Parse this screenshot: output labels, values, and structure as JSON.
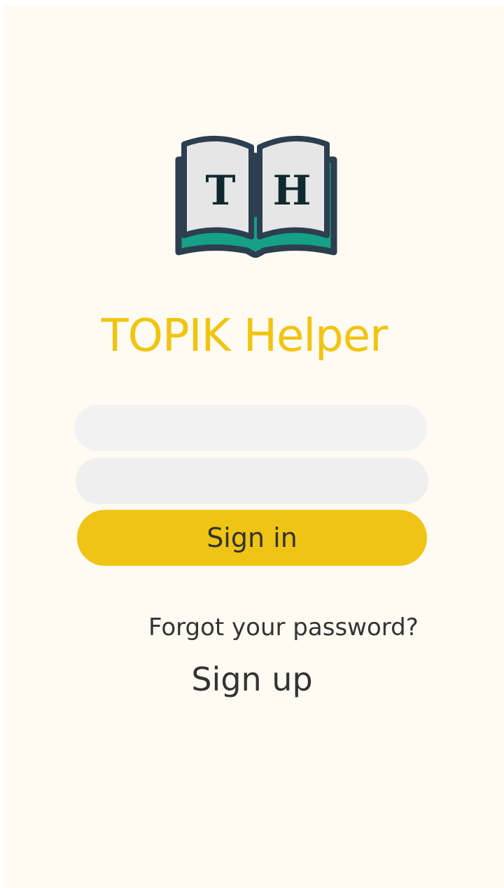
{
  "app": {
    "title": "TOPIK Helper",
    "logo": {
      "letter_left": "T",
      "letter_right": "H",
      "icon": "open-book-icon"
    }
  },
  "login": {
    "email_placeholder": "",
    "password_placeholder": "",
    "signin_label": "Sign in",
    "forgot_label": "Forgot your password?",
    "signup_label": "Sign up"
  },
  "colors": {
    "accent": "#f1c40f",
    "button": "#f0c414",
    "background": "#fffbf3",
    "book_cover": "#2c3e50",
    "book_page_edge": "#16a085",
    "book_page": "#e6e6e6",
    "logo_letters": "#10292e"
  }
}
